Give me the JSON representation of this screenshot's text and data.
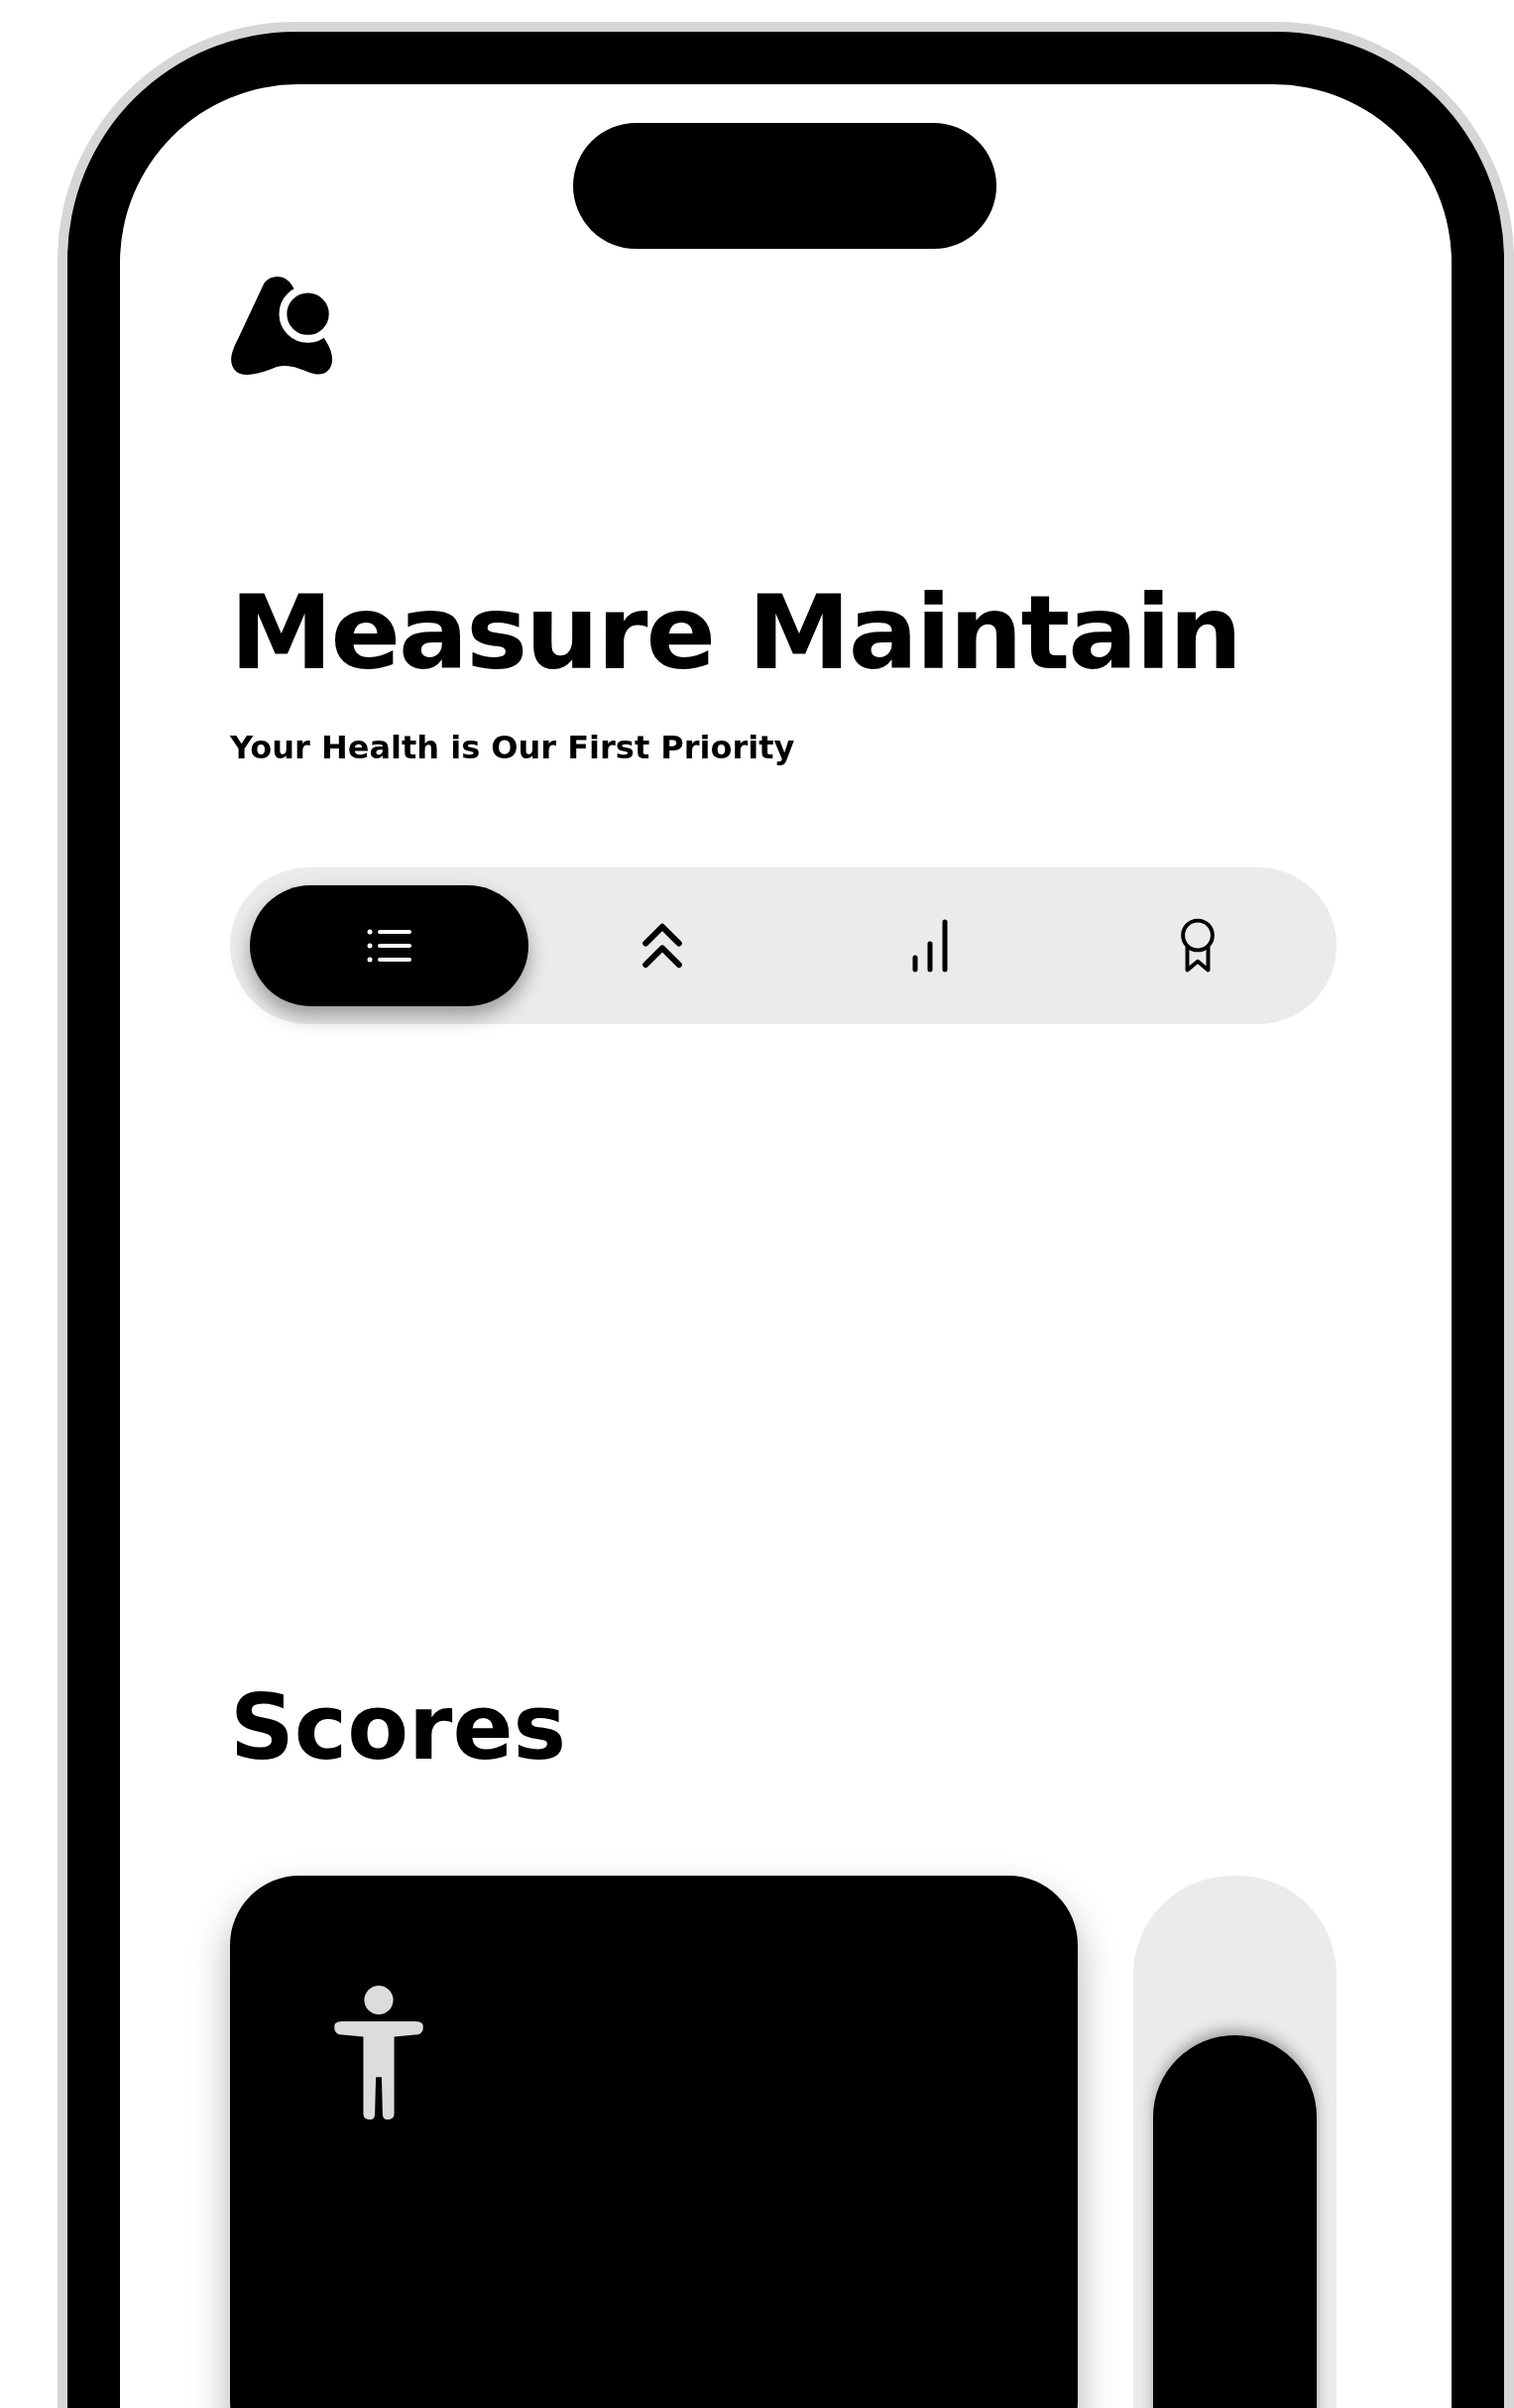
{
  "title": "Measure Maintain",
  "subtitle": "Your Health is Our First Priority",
  "tabs": [
    {
      "kind": "list",
      "selected": true
    },
    {
      "kind": "chevrons",
      "selected": false
    },
    {
      "kind": "bars",
      "selected": false
    },
    {
      "kind": "award",
      "selected": false
    }
  ],
  "section_title": "Scores"
}
